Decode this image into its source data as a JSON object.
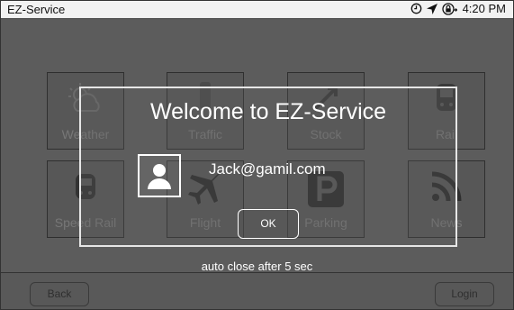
{
  "statusbar": {
    "app_title": "EZ-Service",
    "time": "4:20 PM",
    "icons": [
      "clock-icon",
      "location-arrow-icon",
      "lock-icon"
    ]
  },
  "tiles": [
    {
      "label": "Weather",
      "icon": "weather-icon"
    },
    {
      "label": "Traffic",
      "icon": "traffic-icon"
    },
    {
      "label": "Stock",
      "icon": "stock-icon"
    },
    {
      "label": "Rail",
      "icon": "rail-icon"
    },
    {
      "label": "Speed Rail",
      "icon": "speed-rail-icon"
    },
    {
      "label": "Flight",
      "icon": "flight-icon"
    },
    {
      "label": "Parking",
      "icon": "parking-icon"
    },
    {
      "label": "News",
      "icon": "news-icon"
    }
  ],
  "modal": {
    "title": "Welcome to EZ-Service",
    "user_email": "Jack@gamil.com",
    "ok_label": "OK"
  },
  "auto_close_text": "auto close after 5 sec",
  "bottom": {
    "back_label": "Back",
    "login_label": "Login"
  },
  "colors": {
    "overlay": "#5a5a5a",
    "text_light": "#ffffff",
    "statusbar_bg": "#f2f2f2"
  }
}
